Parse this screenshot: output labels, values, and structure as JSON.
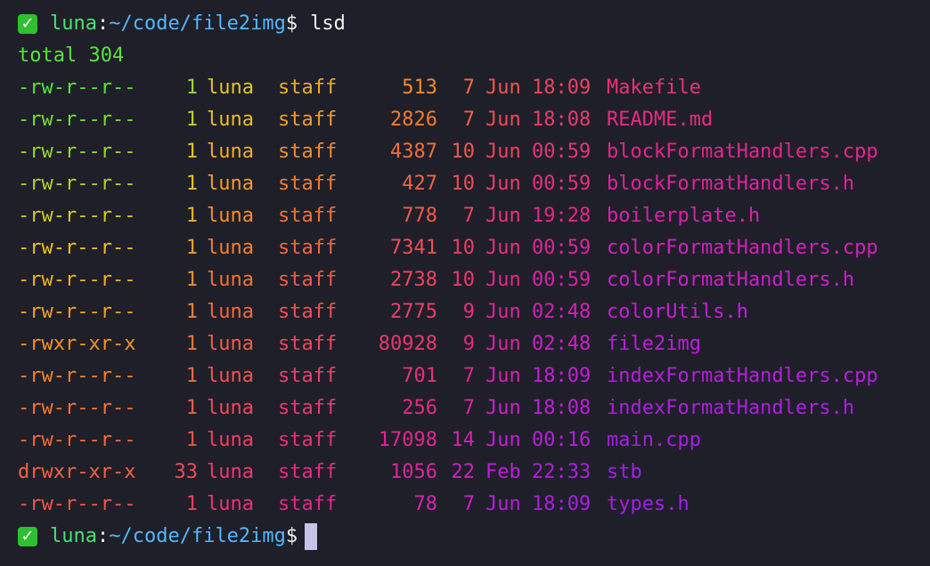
{
  "prompt": {
    "status_icon": "check-mark-icon",
    "status_glyph": "✓",
    "user": "luna",
    "colon": ":",
    "path": "~/code/file2img",
    "dollar": "$"
  },
  "command": "lsd",
  "total_line": "total 304",
  "listing": [
    {
      "perm": "-rw-r--r--",
      "links": "1",
      "user": "luna",
      "group": "staff",
      "size": "513",
      "day": "7",
      "mon": "Jun",
      "time": "18:09",
      "name": "Makefile"
    },
    {
      "perm": "-rw-r--r--",
      "links": "1",
      "user": "luna",
      "group": "staff",
      "size": "2826",
      "day": "7",
      "mon": "Jun",
      "time": "18:08",
      "name": "README.md"
    },
    {
      "perm": "-rw-r--r--",
      "links": "1",
      "user": "luna",
      "group": "staff",
      "size": "4387",
      "day": "10",
      "mon": "Jun",
      "time": "00:59",
      "name": "blockFormatHandlers.cpp"
    },
    {
      "perm": "-rw-r--r--",
      "links": "1",
      "user": "luna",
      "group": "staff",
      "size": "427",
      "day": "10",
      "mon": "Jun",
      "time": "00:59",
      "name": "blockFormatHandlers.h"
    },
    {
      "perm": "-rw-r--r--",
      "links": "1",
      "user": "luna",
      "group": "staff",
      "size": "778",
      "day": "7",
      "mon": "Jun",
      "time": "19:28",
      "name": "boilerplate.h"
    },
    {
      "perm": "-rw-r--r--",
      "links": "1",
      "user": "luna",
      "group": "staff",
      "size": "7341",
      "day": "10",
      "mon": "Jun",
      "time": "00:59",
      "name": "colorFormatHandlers.cpp"
    },
    {
      "perm": "-rw-r--r--",
      "links": "1",
      "user": "luna",
      "group": "staff",
      "size": "2738",
      "day": "10",
      "mon": "Jun",
      "time": "00:59",
      "name": "colorFormatHandlers.h"
    },
    {
      "perm": "-rw-r--r--",
      "links": "1",
      "user": "luna",
      "group": "staff",
      "size": "2775",
      "day": "9",
      "mon": "Jun",
      "time": "02:48",
      "name": "colorUtils.h"
    },
    {
      "perm": "-rwxr-xr-x",
      "links": "1",
      "user": "luna",
      "group": "staff",
      "size": "80928",
      "day": "9",
      "mon": "Jun",
      "time": "02:48",
      "name": "file2img"
    },
    {
      "perm": "-rw-r--r--",
      "links": "1",
      "user": "luna",
      "group": "staff",
      "size": "701",
      "day": "7",
      "mon": "Jun",
      "time": "18:09",
      "name": "indexFormatHandlers.cpp"
    },
    {
      "perm": "-rw-r--r--",
      "links": "1",
      "user": "luna",
      "group": "staff",
      "size": "256",
      "day": "7",
      "mon": "Jun",
      "time": "18:08",
      "name": "indexFormatHandlers.h"
    },
    {
      "perm": "-rw-r--r--",
      "links": "1",
      "user": "luna",
      "group": "staff",
      "size": "17098",
      "day": "14",
      "mon": "Jun",
      "time": "00:16",
      "name": "main.cpp"
    },
    {
      "perm": "drwxr-xr-x",
      "links": "33",
      "user": "luna",
      "group": "staff",
      "size": "1056",
      "day": "22",
      "mon": "Feb",
      "time": "22:33",
      "name": "stb"
    },
    {
      "perm": "-rw-r--r--",
      "links": "1",
      "user": "luna",
      "group": "staff",
      "size": "78",
      "day": "7",
      "mon": "Jun",
      "time": "18:09",
      "name": "types.h"
    }
  ],
  "gradient_stops": [
    "#57e33a",
    "#f0c419",
    "#f57a2c",
    "#f2455a",
    "#e8238a",
    "#c81cd6",
    "#a31ee6"
  ]
}
